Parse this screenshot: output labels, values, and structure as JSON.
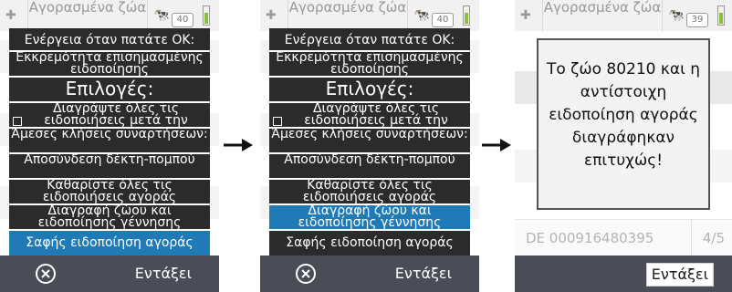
{
  "screens": [
    {
      "topbar": {
        "title": "Αγορασμένα ζώα",
        "badge": "40"
      },
      "menu": {
        "items": [
          {
            "label": "Ενέργεια όταν πατάτε ΟΚ:"
          },
          {
            "label": "Εκκρεμότητα επισημασμένης ειδοποίησης"
          },
          {
            "label": "Επιλογές:"
          },
          {
            "label": "Διαγράψτε όλες τις ειδοποιήσεις μετά την"
          },
          {
            "label": "Άμεσες κλήσεις συναρτήσεων:"
          },
          {
            "label": "Αποσύνδεση δέκτη-πομπού"
          },
          {
            "label": "Καθαρίστε όλες τις ειδοποιήσεις αγοράς"
          },
          {
            "label": "Διαγραφή ζώου και ειδοποίησης γέννησης"
          },
          {
            "label": "Σαφής ειδοποίηση αγοράς"
          }
        ]
      },
      "bottom": {
        "ok_label": "Εντάξει"
      }
    },
    {
      "topbar": {
        "title": "Αγορασμένα ζώα",
        "badge": "40"
      },
      "menu": {
        "items": [
          {
            "label": "Ενέργεια όταν πατάτε ΟΚ:"
          },
          {
            "label": "Εκκρεμότητα επισημασμένης ειδοποίησης"
          },
          {
            "label": "Επιλογές:"
          },
          {
            "label": "Διαγράψτε όλες τις ειδοποιήσεις μετά την"
          },
          {
            "label": "Άμεσες κλήσεις συναρτήσεων:"
          },
          {
            "label": "Αποσύνδεση δέκτη-πομπού"
          },
          {
            "label": "Καθαρίστε όλες τις ειδοποιήσεις αγοράς"
          },
          {
            "label": "Διαγραφή ζώου και ειδοποίησης γέννησης"
          },
          {
            "label": "Σαφής ειδοποίηση αγοράς"
          }
        ]
      },
      "bottom": {
        "ok_label": "Εντάξει"
      }
    },
    {
      "topbar": {
        "title": "Αγορασμένα ζώα",
        "badge": "39"
      },
      "popup": {
        "message": "Το ζώο 80210 και η αντίστοιχη ειδοποίηση αγοράς διαγράφηκαν επιτυχώς!"
      },
      "list": [
        {
          "id": "DE 000916480395",
          "position": "4/5"
        }
      ],
      "bottom": {
        "ok_label": "Εντάξει"
      }
    }
  ],
  "colors": {
    "menu_bg": "#2b2b2b",
    "selected": "#1f7ab6",
    "bottom_bar": "#4a4d57"
  },
  "icons": {
    "cancel": "circle-x-icon",
    "arrow": "right-arrow-icon",
    "animal": "cow-icon",
    "scanner": "scanner-icon",
    "battery": "battery-icon"
  }
}
